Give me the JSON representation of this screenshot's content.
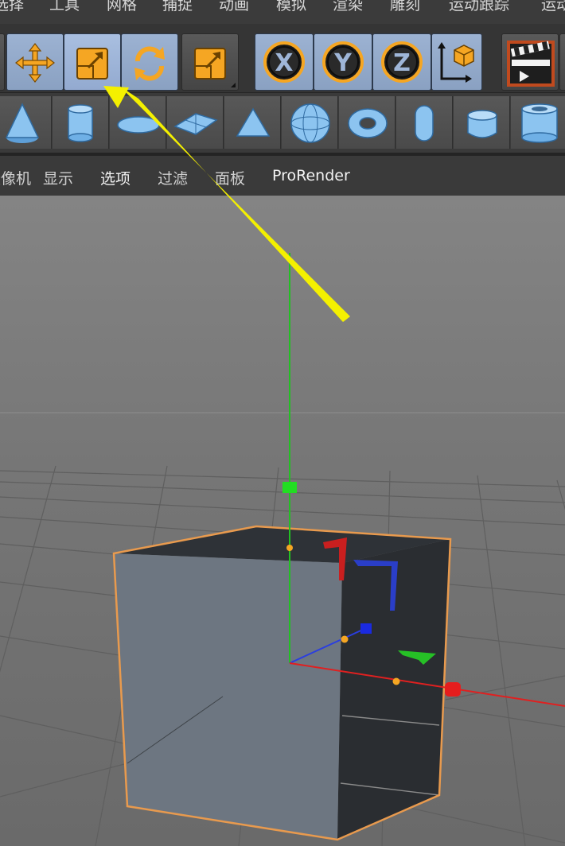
{
  "main_menu": {
    "items": [
      "选择",
      "工具",
      "网格",
      "捕捉",
      "动画",
      "模拟",
      "渲染",
      "雕刻",
      "运动跟踪",
      "运动"
    ]
  },
  "toolbar": {
    "tools": [
      {
        "icon": "move-tool-icon",
        "selected": false
      },
      {
        "icon": "scale-tool-icon",
        "selected": true
      },
      {
        "icon": "rotate-tool-icon",
        "selected": false
      },
      {
        "icon": "recent-tools-icon",
        "selected": false
      }
    ],
    "axis_locks": [
      "X",
      "Y",
      "Z"
    ],
    "coordinate_system_icon": "world-coordinate-icon",
    "render_icon": "clapperboard-icon"
  },
  "primitives": {
    "icons": [
      "cone-icon",
      "cylinder-icon",
      "disc-icon",
      "plane-icon",
      "pyramid-icon",
      "sphere-icon",
      "torus-icon",
      "capsule-icon",
      "oil-tank-icon",
      "tube-icon"
    ]
  },
  "viewport_menu": {
    "items": [
      "摄像机",
      "显示",
      "选项",
      "过滤",
      "面板",
      "ProRender"
    ],
    "visible_first": "像机"
  },
  "colors": {
    "accent_orange": "#f5a623",
    "tool_highlight": "#9fb6d8",
    "axis_x": "#e02020",
    "axis_y": "#22c022",
    "axis_z": "#2030e0",
    "selection_outline": "#e89a4e",
    "annotation_arrow": "#f4f000"
  }
}
